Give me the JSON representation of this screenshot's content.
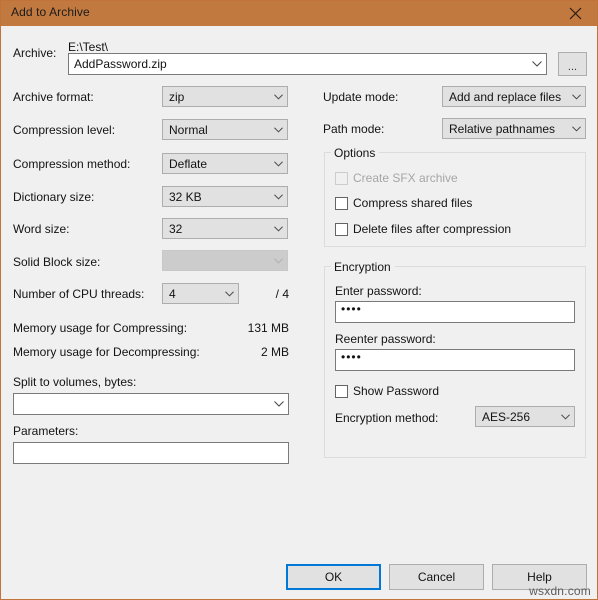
{
  "window": {
    "title": "Add to Archive",
    "close_icon": "close-icon",
    "titlebar_color": "#c1793f",
    "border_color": "#c1733a",
    "body_color": "#f0f0f0"
  },
  "archive": {
    "label": "Archive:",
    "path": "E:\\Test\\",
    "filename": "AddPassword.zip",
    "browse_label": "..."
  },
  "left_column": {
    "archive_format": {
      "label": "Archive format:",
      "value": "zip"
    },
    "compression_level": {
      "label": "Compression level:",
      "value": "Normal"
    },
    "compression_method": {
      "label": "Compression method:",
      "value": "Deflate"
    },
    "dictionary_size": {
      "label": "Dictionary size:",
      "value": "32 KB"
    },
    "word_size": {
      "label": "Word size:",
      "value": "32"
    },
    "solid_block_size": {
      "label": "Solid Block size:",
      "value": "",
      "disabled": true
    },
    "cpu_threads": {
      "label": "Number of CPU threads:",
      "value": "4",
      "suffix": "/ 4"
    },
    "memory_compressing": {
      "label": "Memory usage for Compressing:",
      "value": "131 MB"
    },
    "memory_decompressing": {
      "label": "Memory usage for Decompressing:",
      "value": "2 MB"
    },
    "split_volumes": {
      "label": "Split to volumes, bytes:",
      "value": ""
    },
    "parameters": {
      "label": "Parameters:",
      "value": ""
    }
  },
  "right_column": {
    "update_mode": {
      "label": "Update mode:",
      "value": "Add and replace files"
    },
    "path_mode": {
      "label": "Path mode:",
      "value": "Relative pathnames"
    },
    "options": {
      "title": "Options",
      "items": [
        {
          "label": "Create SFX archive",
          "checked": false,
          "disabled": true
        },
        {
          "label": "Compress shared files",
          "checked": false,
          "disabled": false
        },
        {
          "label": "Delete files after compression",
          "checked": false,
          "disabled": false
        }
      ]
    },
    "encryption": {
      "title": "Encryption",
      "enter_password": {
        "label": "Enter password:",
        "value": "••••"
      },
      "reenter_password": {
        "label": "Reenter password:",
        "value": "••••"
      },
      "show_password": {
        "label": "Show Password",
        "checked": false
      },
      "encryption_method": {
        "label": "Encryption method:",
        "value": "AES-256"
      }
    }
  },
  "buttons": {
    "ok": "OK",
    "cancel": "Cancel",
    "help": "Help"
  },
  "watermark": "wsxdn.com"
}
